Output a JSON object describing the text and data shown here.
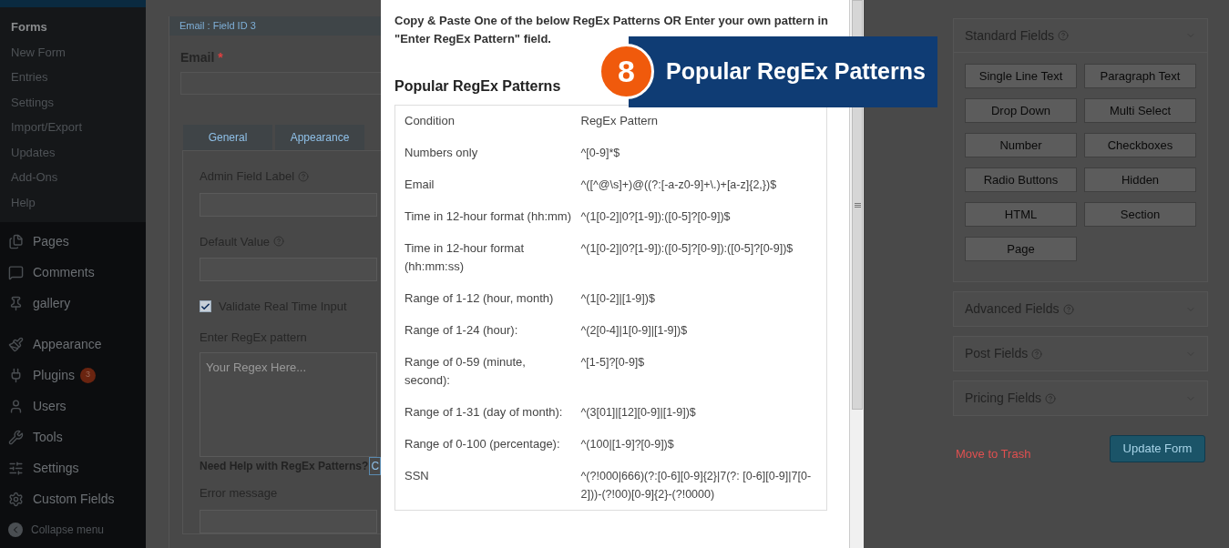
{
  "sidebar": {
    "submenu": [
      {
        "label": "Forms",
        "selected": true
      },
      {
        "label": "New Form",
        "selected": false
      },
      {
        "label": "Entries",
        "selected": false
      },
      {
        "label": "Settings",
        "selected": false
      },
      {
        "label": "Import/Export",
        "selected": false
      },
      {
        "label": "Updates",
        "selected": false
      },
      {
        "label": "Add-Ons",
        "selected": false
      },
      {
        "label": "Help",
        "selected": false
      }
    ],
    "menu": [
      {
        "label": "Pages"
      },
      {
        "label": "Comments"
      },
      {
        "label": "gallery"
      },
      {
        "label": "Appearance"
      },
      {
        "label": "Plugins",
        "badge": "3"
      },
      {
        "label": "Users"
      },
      {
        "label": "Tools"
      },
      {
        "label": "Settings"
      },
      {
        "label": "Custom Fields"
      }
    ],
    "collapse": "Collapse menu"
  },
  "field_editor": {
    "header": "Email : Field ID 3",
    "field_label": "Email",
    "required_mark": "*",
    "tabs": [
      {
        "label": "General",
        "selected": false
      },
      {
        "label": "Appearance",
        "selected": false
      }
    ],
    "admin_label": "Admin Field Label",
    "default_value": "Default Value",
    "validate": {
      "label": "Validate Real Time Input",
      "checked": true
    },
    "regex_label": "Enter RegEx pattern",
    "regex_placeholder": "Your Regex Here...",
    "help_text": "Need Help with RegEx Patterns?",
    "help_link": "C",
    "error_label": "Error message"
  },
  "modal": {
    "intro": "Copy & Paste One of the below RegEx Patterns OR Enter your own pattern in \"Enter RegEx Pattern\" field.",
    "heading": "Popular RegEx Patterns",
    "columns": [
      "Condition",
      "RegEx Pattern"
    ],
    "rows": [
      {
        "condition": "Numbers only",
        "pattern": "^[0-9]*$"
      },
      {
        "condition": "Email",
        "pattern": "^([^@\\s]+)@((?:[-a-z0-9]+\\.)+[a-z]{2,})$"
      },
      {
        "condition": "Time in 12-hour format (hh:mm)",
        "pattern": "^(1[0-2]|0?[1-9]):([0-5]?[0-9])$"
      },
      {
        "condition": "Time in 12-hour format (hh:mm:ss)",
        "pattern": "^(1[0-2]|0?[1-9]):([0-5]?[0-9]):([0-5]?[0-9])$"
      },
      {
        "condition": "Range of 1-12 (hour, month)",
        "pattern": "^(1[0-2]|[1-9])$"
      },
      {
        "condition": "Range of 1-24 (hour):",
        "pattern": "^(2[0-4]|1[0-9]|[1-9])$"
      },
      {
        "condition": "Range of 0-59 (minute, second):",
        "pattern": "^[1-5]?[0-9]$"
      },
      {
        "condition": "Range of 1-31 (day of month):",
        "pattern": "^(3[01]|[12][0-9]|[1-9])$"
      },
      {
        "condition": "Range of 0-100 (percentage):",
        "pattern": "^(100|[1-9]?[0-9])$"
      },
      {
        "condition": "SSN",
        "pattern": "^(?!000|666)(?:[0-6][0-9]{2}|7(?: [0-6][0-9]|7[0-2]))-(?!00)[0-9]{2}-(?!0000)"
      }
    ]
  },
  "callout": {
    "number": "8",
    "title": "Popular RegEx Patterns"
  },
  "field_panels": [
    {
      "title": "Standard Fields",
      "expanded": true,
      "buttons": [
        "Single Line Text",
        "Paragraph Text",
        "Drop Down",
        "Multi Select",
        "Number",
        "Checkboxes",
        "Radio Buttons",
        "Hidden",
        "HTML",
        "Section",
        "Page"
      ]
    },
    {
      "title": "Advanced Fields",
      "expanded": false
    },
    {
      "title": "Post Fields",
      "expanded": false
    },
    {
      "title": "Pricing Fields",
      "expanded": false
    }
  ],
  "trash_link": "Move to Trash",
  "update_button": "Update Form"
}
